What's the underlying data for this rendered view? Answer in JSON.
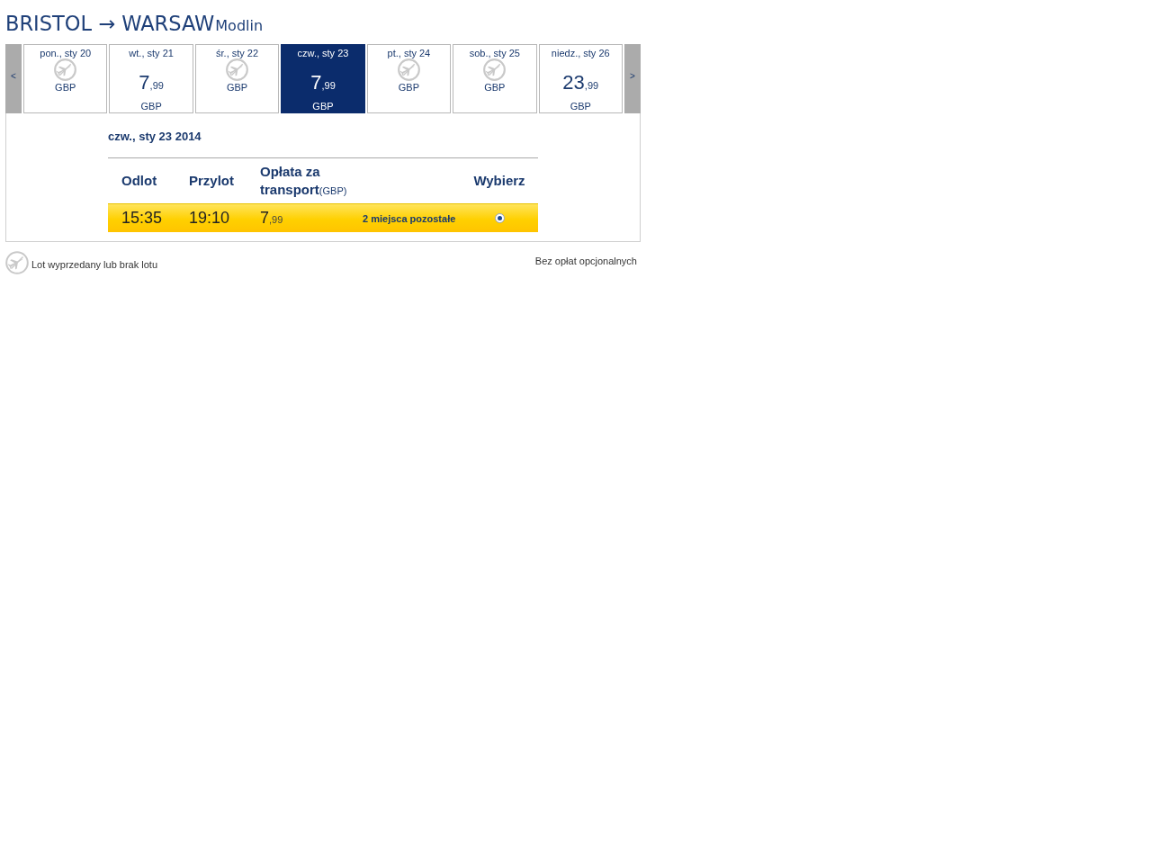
{
  "header": {
    "route": "BRISTOL → WARSAW",
    "airport": "Modlin"
  },
  "date_strip": {
    "prev": "<",
    "next": ">",
    "days": [
      {
        "label": "pon., sty 20",
        "sold_out": true,
        "currency": "GBP",
        "selected": false
      },
      {
        "label": "wt., sty 21",
        "sold_out": false,
        "price": "7",
        "cents": ",99",
        "currency": "GBP",
        "selected": false
      },
      {
        "label": "śr., sty 22",
        "sold_out": true,
        "currency": "GBP",
        "selected": false
      },
      {
        "label": "czw., sty 23",
        "sold_out": false,
        "price": "7",
        "cents": ",99",
        "currency": "GBP",
        "selected": true
      },
      {
        "label": "pt., sty 24",
        "sold_out": true,
        "currency": "GBP",
        "selected": false
      },
      {
        "label": "sob., sty 25",
        "sold_out": true,
        "currency": "GBP",
        "selected": false
      },
      {
        "label": "niedz., sty 26",
        "sold_out": false,
        "price": "23",
        "cents": ",99",
        "currency": "GBP",
        "selected": false
      }
    ]
  },
  "flights_panel": {
    "date": "czw., sty 23 2014",
    "columns": [
      {
        "label": "Odlot"
      },
      {
        "label": "Przylot"
      },
      {
        "label": "Opłata za transport",
        "unit": "(GBP)"
      },
      {
        "label": "Wybierz"
      }
    ],
    "flights": [
      {
        "departure": "15:35",
        "arrival": "19:10",
        "price": "7",
        "cents": ",99",
        "seats_left": "2 miejsca pozostałe",
        "selected": true
      }
    ]
  },
  "legend": {
    "text": "Lot wyprzedany lub brak lotu"
  },
  "note": "Bez opłat opcjonalnych"
}
